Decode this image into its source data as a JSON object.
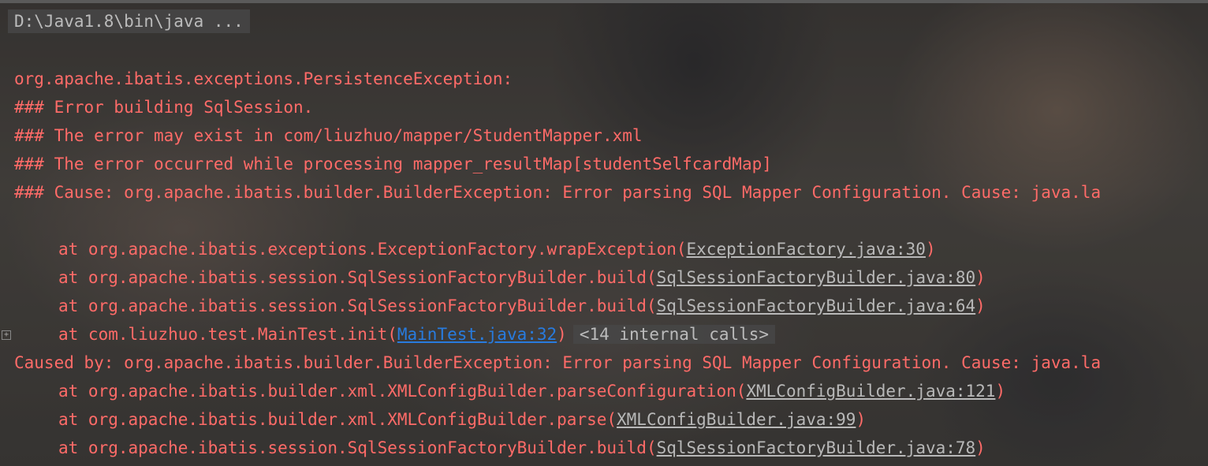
{
  "console": {
    "command": "D:\\Java1.8\\bin\\java ...",
    "lines": [
      "org.apache.ibatis.exceptions.PersistenceException: ",
      "### Error building SqlSession.",
      "### The error may exist in com/liuzhuo/mapper/StudentMapper.xml",
      "### The error occurred while processing mapper_resultMap[studentSelfcardMap]",
      "### Cause: org.apache.ibatis.builder.BuilderException: Error parsing SQL Mapper Configuration. Cause: java.la"
    ],
    "trace": [
      {
        "prefix": "at org.apache.ibatis.exceptions.ExceptionFactory.wrapException(",
        "link": "ExceptionFactory.java:30",
        "suffix": ")"
      },
      {
        "prefix": "at org.apache.ibatis.session.SqlSessionFactoryBuilder.build(",
        "link": "SqlSessionFactoryBuilder.java:80",
        "suffix": ")"
      },
      {
        "prefix": "at org.apache.ibatis.session.SqlSessionFactoryBuilder.build(",
        "link": "SqlSessionFactoryBuilder.java:64",
        "suffix": ")"
      },
      {
        "prefix": "at com.liuzhuo.test.MainTest.init(",
        "link": "MainTest.java:32",
        "suffix": ")",
        "internal": "<14 internal calls>"
      }
    ],
    "caused_by": "Caused by: org.apache.ibatis.builder.BuilderException: Error parsing SQL Mapper Configuration. Cause: java.la",
    "trace2": [
      {
        "prefix": "at org.apache.ibatis.builder.xml.XMLConfigBuilder.parseConfiguration(",
        "link": "XMLConfigBuilder.java:121",
        "suffix": ")"
      },
      {
        "prefix": "at org.apache.ibatis.builder.xml.XMLConfigBuilder.parse(",
        "link": "XMLConfigBuilder.java:99",
        "suffix": ")"
      },
      {
        "prefix": "at org.apache.ibatis.session.SqlSessionFactoryBuilder.build(",
        "link": "SqlSessionFactoryBuilder.java:78",
        "suffix": ")"
      }
    ],
    "colors": {
      "error": "#ff6b68",
      "link": "#b8b8b8",
      "link_blue": "#287bde",
      "muted": "#bbbbbb"
    }
  }
}
